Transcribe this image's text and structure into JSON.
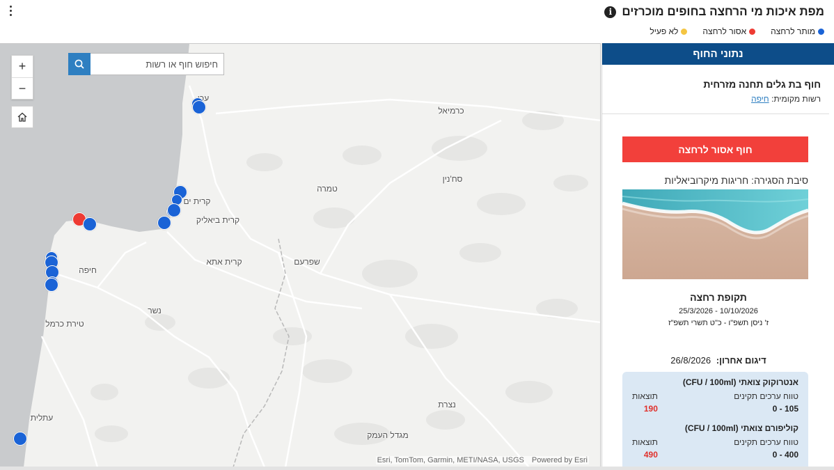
{
  "header": {
    "title": "מפת איכות מי הרחצה בחופים מוכרזים",
    "info_icon": "info-icon",
    "menu_icon": "more-vertical-icon",
    "legend": [
      {
        "label": "מותר לרחצה",
        "color": "#1a63d6"
      },
      {
        "label": "אסור לרחצה",
        "color": "#ee3b33"
      },
      {
        "label": "לא פעיל",
        "color": "#f4c542"
      }
    ]
  },
  "map": {
    "search_placeholder": "חיפוש חוף או רשות",
    "zoom_in": "+",
    "zoom_out": "−",
    "attribution": "Esri, TomTom, Garmin, METI/NASA, USGS",
    "powered_by": "Powered by Esri",
    "places": [
      "עכו",
      "כרמיאל",
      "סח'נין",
      "טמרה",
      "קרית ים",
      "קרית ביאליק",
      "קרית אתא",
      "שפרעם",
      "חיפה",
      "נשר",
      "טירת כרמל",
      "נצרת",
      "עתלית",
      "מגדל העמק"
    ],
    "beach_status_colors": {
      "allowed": "#1a63d6",
      "forbidden": "#ee3b33"
    }
  },
  "panel": {
    "header": "נתוני החוף",
    "beach_name": "חוף בת גלים תחנה מזרחית",
    "authority_label": "רשות מקומית:",
    "authority_value": "חיפה",
    "status_label": "חוף אסור לרחצה",
    "status_color": "#f2403b",
    "closure_reason": "סיבת הסגירה: חריגות מיקרוביאליות",
    "season_title": "תקופת רחצה",
    "season_dates": "25/3/2026 - 10/10/2026",
    "season_heb": "ז' ניסן תשפ\"ו - כ\"ט תשרי תשפ\"ז",
    "last_sample_label": "דיגום אחרון:",
    "last_sample_date": "26/8/2026",
    "metrics": [
      {
        "title": "אנטרוקוק צואתי (CFU / 100ml)",
        "range_label": "טווח ערכים תקינים",
        "results_label": "תוצאות",
        "range_value": "0 - 105",
        "result_value": "190"
      },
      {
        "title": "קוליפורם צואתי (CFU / 100ml)",
        "range_label": "טווח ערכים תקינים",
        "results_label": "תוצאות",
        "range_value": "0 - 400",
        "result_value": "490"
      }
    ]
  }
}
